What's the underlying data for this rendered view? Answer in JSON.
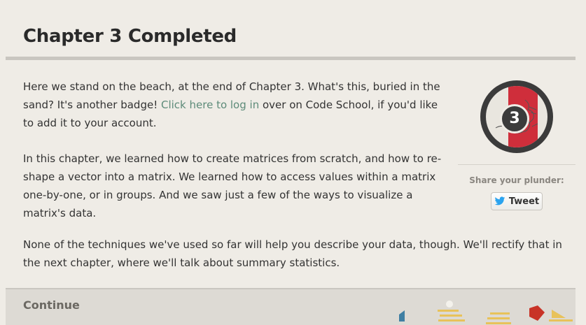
{
  "page": {
    "title": "Chapter 3 Completed"
  },
  "content": {
    "p1_before": "Here we stand on the beach, at the end of Chapter 3. What's this, buried in the sand? It's another badge! ",
    "p1_link": "Click here to log in",
    "p1_after": " over on Code School, if you'd like to add it to your account.",
    "p2": "In this chapter, we learned how to create matrices from scratch, and how to re-shape a vector into a matrix. We learned how to access values within a matrix one-by-one, or in groups. And we saw just a few of the ways to visualize a matrix's data.",
    "p3": "None of the techniques we've used so far will help you describe your data, though. We'll rectify that in the next chapter, where we'll talk about summary statistics."
  },
  "badge": {
    "number": "3",
    "accent_color": "#cf2e3b"
  },
  "share": {
    "label": "Share your plunder:",
    "tweet_label": "Tweet",
    "icon": "twitter-bird-icon",
    "twitter_color": "#2aa3ef"
  },
  "footer": {
    "continue_label": "Continue"
  }
}
